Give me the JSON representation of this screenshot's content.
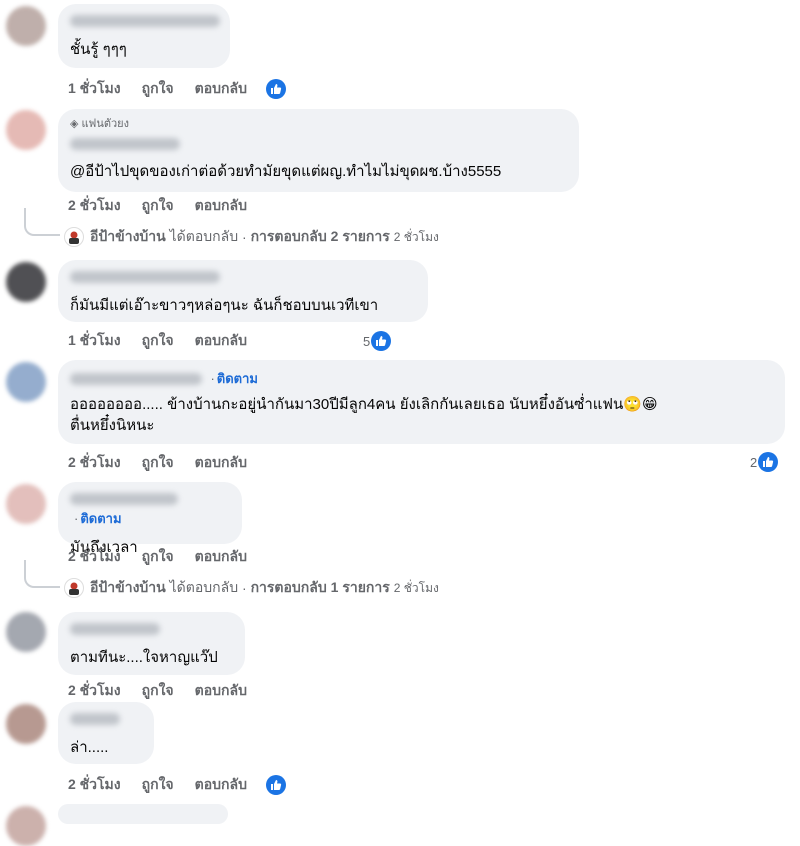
{
  "comments": [
    {
      "text": "ชั้นรู้ ๆๆๆ",
      "time": "1 ชั่วโมง",
      "like": "ถูกใจ",
      "reply": "ตอบกลับ"
    },
    {
      "badge": "แฟนตัวยง",
      "text": "@อีป้าไปขุดของเก่าต่อด้วยทำมัยขุดแต่ผญ.ทำไมไม่ขุดผช.บ้าง5555",
      "time": "2 ชั่วโมง",
      "like": "ถูกใจ",
      "reply": "ตอบกลับ",
      "replies": {
        "author": "อีป้าข้างบ้าน",
        "action": "ได้ตอบกลับ",
        "sep": "·",
        "summary": "การตอบกลับ 2 รายการ",
        "time": "2 ชั่วโมง"
      }
    },
    {
      "text": "ก็มันมีแต่เอ๊าะขาวๆหล่อๆนะ ฉันก็ชอบบนเวทีเขา",
      "time": "1 ชั่วโมง",
      "like": "ถูกใจ",
      "reply": "ตอบกลับ",
      "reaction_count": "5"
    },
    {
      "follow": "ติดตาม",
      "text_line1": "ออออออออ..... ข้างบ้านกะอยู่นำกันมา30ปีมีลูก4คน ยังเลิกกันเลยเธอ นับหยึ๋งอันซ่ำแฟน🙄😁",
      "text_line2": "ตื่นหยึ๋งนิหนะ",
      "time": "2 ชั่วโมง",
      "like": "ถูกใจ",
      "reply": "ตอบกลับ",
      "reaction_count": "2"
    },
    {
      "follow": "ติดตาม",
      "text": "มันถึงเวลา",
      "time": "2 ชั่วโมง",
      "like": "ถูกใจ",
      "reply": "ตอบกลับ",
      "replies": {
        "author": "อีป้าข้างบ้าน",
        "action": "ได้ตอบกลับ",
        "sep": "·",
        "summary": "การตอบกลับ 1 รายการ",
        "time": "2 ชั่วโมง"
      }
    },
    {
      "text": "ตามทีนะ....ใจหาญแว๊ป",
      "time": "2 ชั่วโมง",
      "like": "ถูกใจ",
      "reply": "ตอบกลับ"
    },
    {
      "text": "ล่า.....",
      "time": "2 ชั่วโมง",
      "like": "ถูกใจ",
      "reply": "ตอบกลับ"
    }
  ],
  "colors": {
    "accent": "#1b74e4",
    "follow": "#1d6bd6",
    "bubble": "#f0f2f5",
    "meta": "#65676b"
  },
  "icons": {
    "like": "thumbs-up-icon",
    "badge": "diamond-icon"
  }
}
